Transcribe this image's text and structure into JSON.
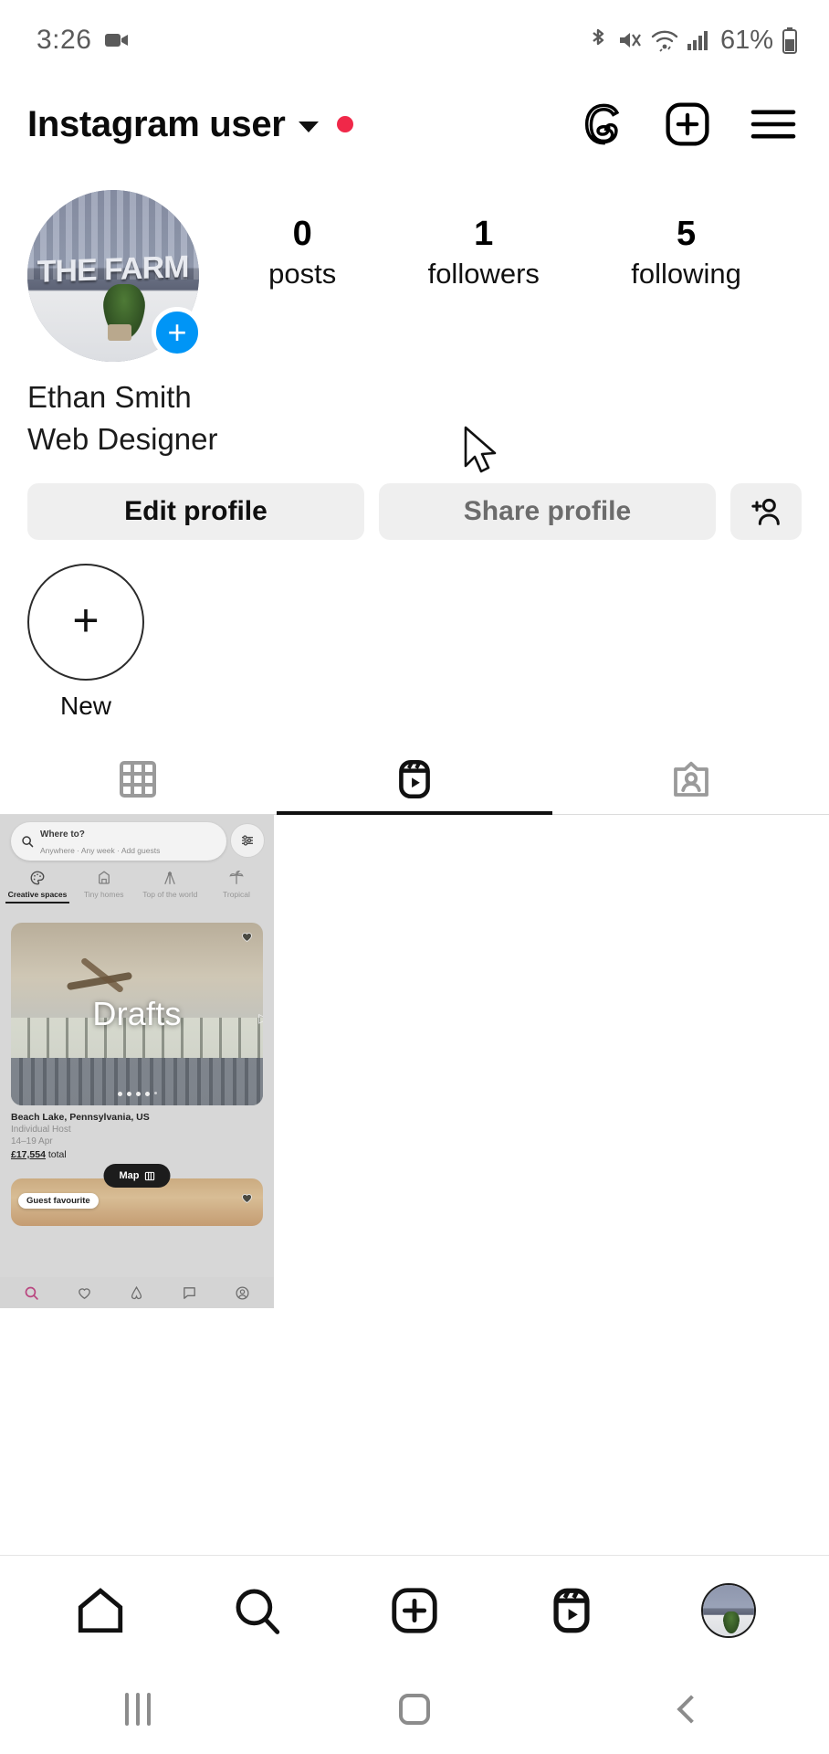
{
  "status_bar": {
    "time": "3:26",
    "battery_percent": "61%",
    "icons": [
      "video-recording-icon",
      "bluetooth-icon",
      "mute-icon",
      "wifi-icon",
      "cellular-signal-icon",
      "battery-icon"
    ]
  },
  "header": {
    "username": "Instagram user",
    "has_unread_dot": true,
    "dot_color": "#f02849",
    "actions": [
      "threads-icon",
      "new-post-icon",
      "menu-icon"
    ]
  },
  "profile": {
    "avatar_label": "THE FARM",
    "add_story_badge": "+",
    "badge_color": "#0095f6",
    "stats": [
      {
        "value": "0",
        "label": "posts"
      },
      {
        "value": "1",
        "label": "followers"
      },
      {
        "value": "5",
        "label": "following"
      }
    ],
    "full_name": "Ethan Smith",
    "bio": "Web Designer"
  },
  "actions": {
    "edit_profile": "Edit profile",
    "share_profile": "Share profile",
    "add_user": "add-person-icon"
  },
  "highlights": [
    {
      "label": "New",
      "icon": "plus-icon"
    }
  ],
  "tabs": [
    {
      "name": "grid",
      "icon": "grid-icon",
      "active": false
    },
    {
      "name": "reels",
      "icon": "reels-icon",
      "active": true
    },
    {
      "name": "tagged",
      "icon": "tagged-icon",
      "active": false
    }
  ],
  "content": {
    "draft": {
      "overlay_label": "Drafts",
      "inner_app": {
        "search": {
          "title": "Where to?",
          "subtitle": "Anywhere · Any week · Add guests",
          "icon": "search-icon",
          "filter_icon": "filter-icon"
        },
        "categories": [
          {
            "label": "Creative spaces",
            "selected": true
          },
          {
            "label": "Tiny homes",
            "selected": false
          },
          {
            "label": "Top of the world",
            "selected": false
          },
          {
            "label": "Tropical",
            "selected": false
          }
        ],
        "listing": {
          "location": "Beach Lake, Pennsylvania, US",
          "host": "Individual Host",
          "dates": "14–19 Apr",
          "price": "£17,554",
          "price_suffix": " total"
        },
        "map_button": "Map",
        "badge": "Guest favourite",
        "bottom_nav": [
          "search-icon",
          "wishlist-heart-icon",
          "airbnb-logo-icon",
          "messages-icon",
          "profile-icon"
        ]
      }
    }
  },
  "bottom_nav": [
    {
      "name": "home",
      "icon": "home-icon"
    },
    {
      "name": "search",
      "icon": "search-icon"
    },
    {
      "name": "create",
      "icon": "create-post-icon"
    },
    {
      "name": "reels",
      "icon": "reels-icon"
    },
    {
      "name": "profile",
      "icon": "profile-avatar"
    }
  ],
  "system_nav": [
    {
      "name": "recents",
      "icon": "recents-icon"
    },
    {
      "name": "home",
      "icon": "home-square-icon"
    },
    {
      "name": "back",
      "icon": "back-chevron-icon"
    }
  ]
}
